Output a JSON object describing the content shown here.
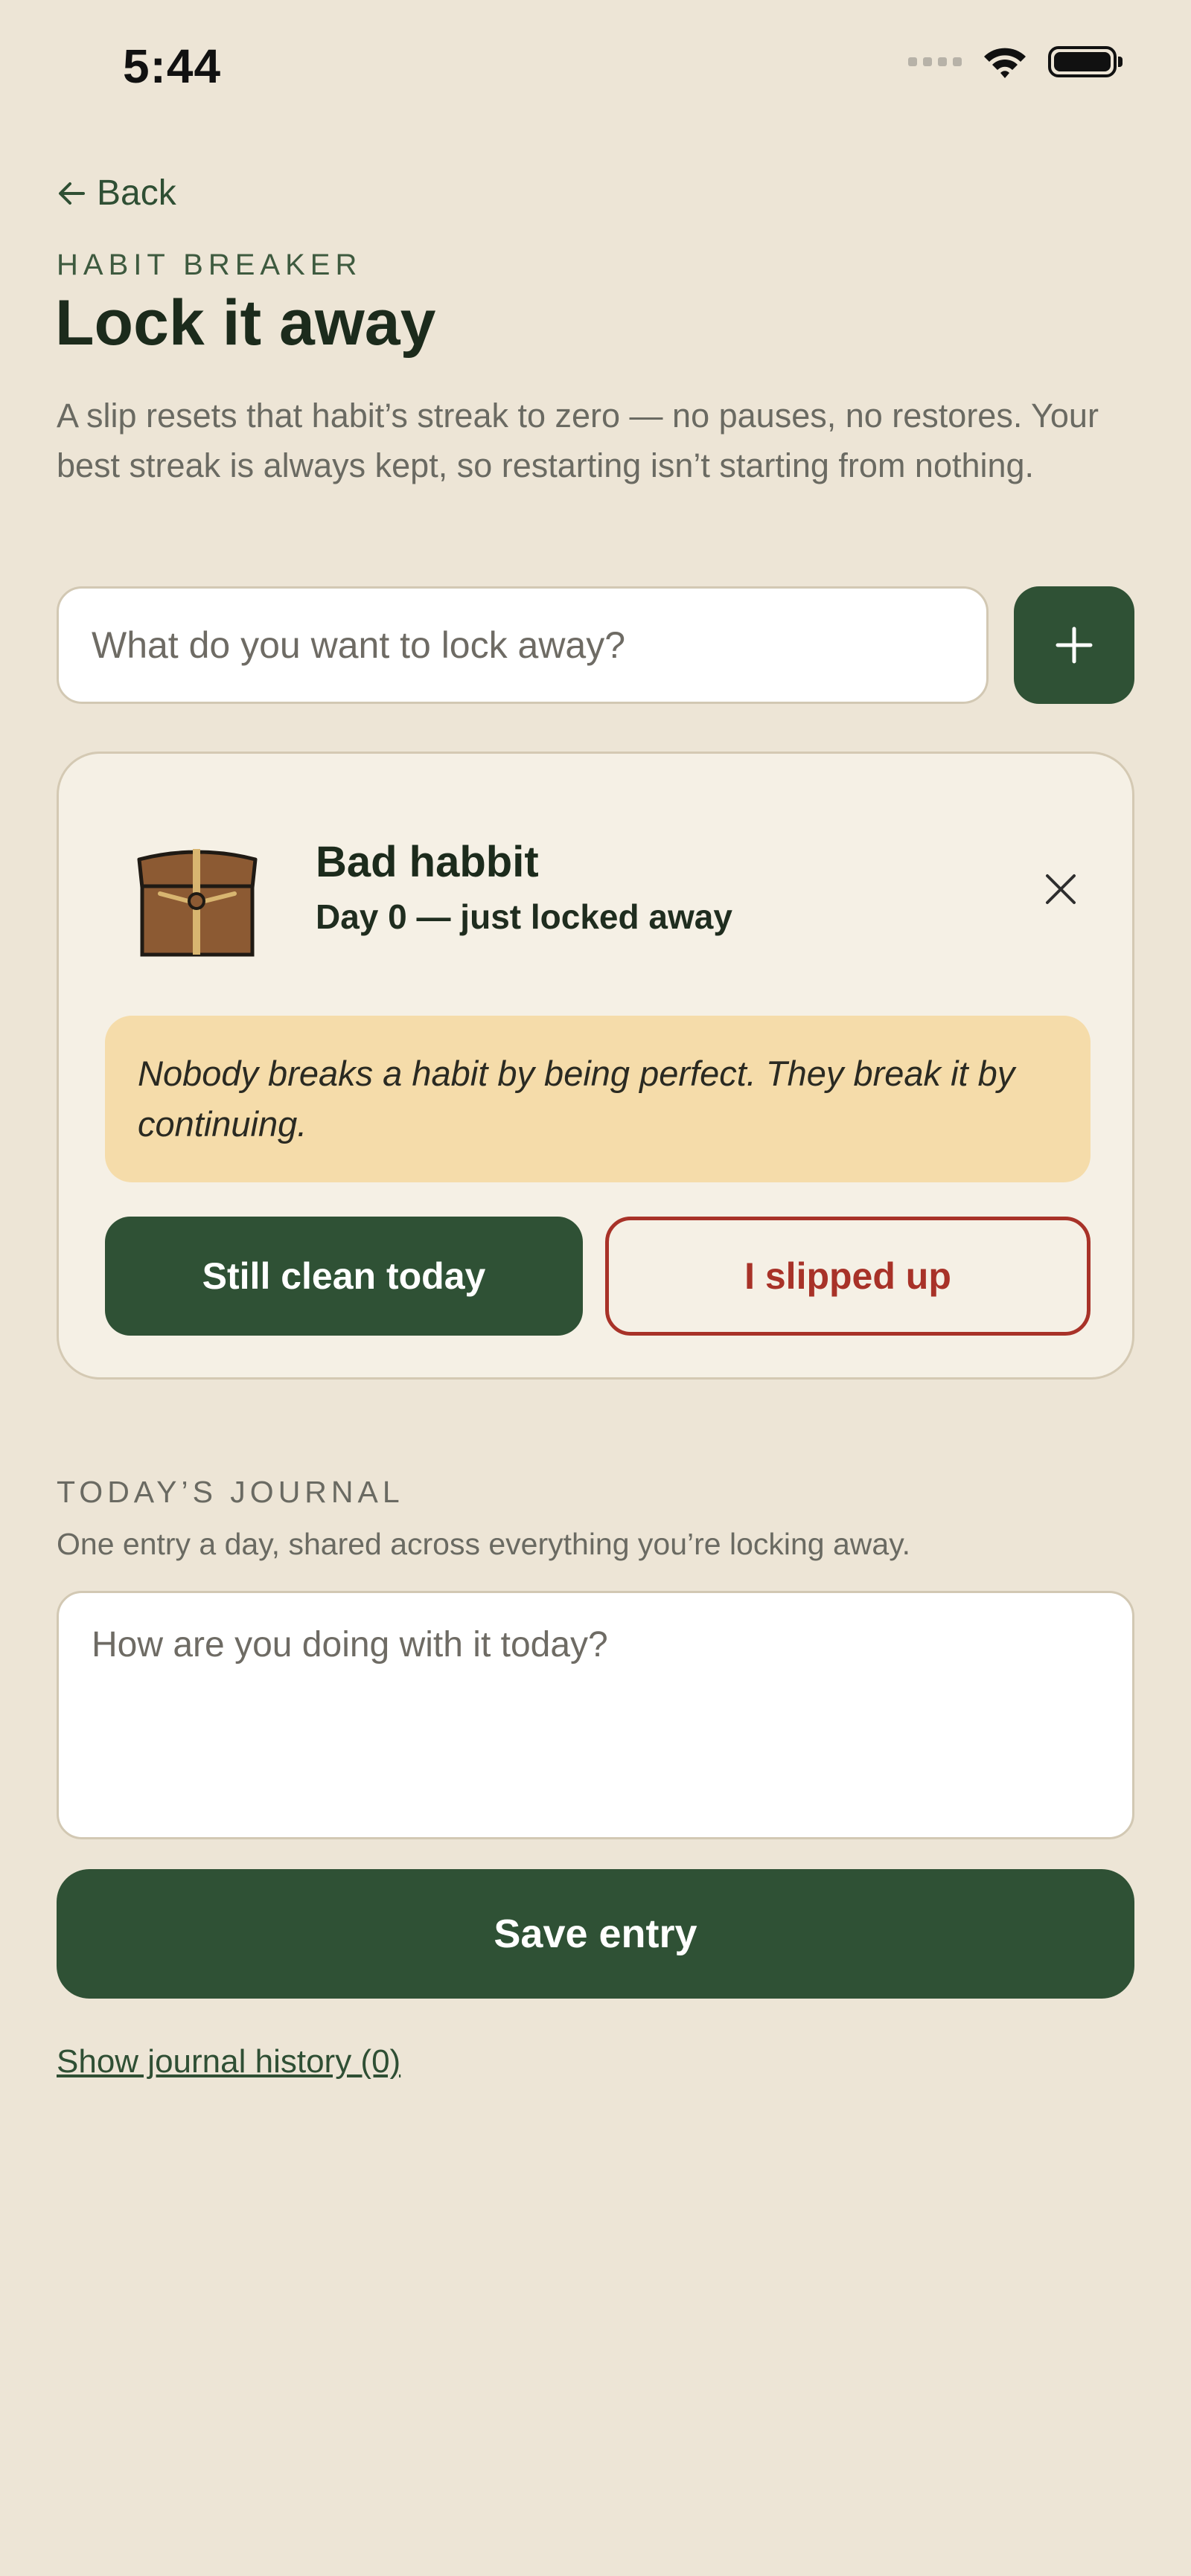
{
  "status_bar": {
    "time": "5:44"
  },
  "nav": {
    "back_label": "Back"
  },
  "header": {
    "eyebrow": "HABIT BREAKER",
    "title": "Lock it away",
    "description": "A slip resets that habit’s streak to zero — no pauses, no restores. Your best streak is always kept, so restarting isn’t starting from nothing."
  },
  "add_habit": {
    "placeholder": "What do you want to lock away?",
    "value": "",
    "button_icon": "plus-icon"
  },
  "habit_card": {
    "icon": "treasure-chest-icon",
    "name": "Bad habbit",
    "status": "Day 0 — just locked away",
    "quote": "Nobody breaks a habit by being perfect. They break it by continuing.",
    "clean_label": "Still clean today",
    "slip_label": "I slipped up"
  },
  "journal": {
    "heading": "TODAY’S JOURNAL",
    "subheading": "One entry a day, shared across everything you’re locking away.",
    "placeholder": "How are you doing with it today?",
    "save_label": "Save entry",
    "history_label": "Show journal history (0)"
  },
  "colors": {
    "background": "#ede5d6",
    "primary": "#2f5135",
    "danger": "#a83228",
    "quote_bg": "#f5dcaa",
    "card_bg": "#f5f0e5"
  }
}
